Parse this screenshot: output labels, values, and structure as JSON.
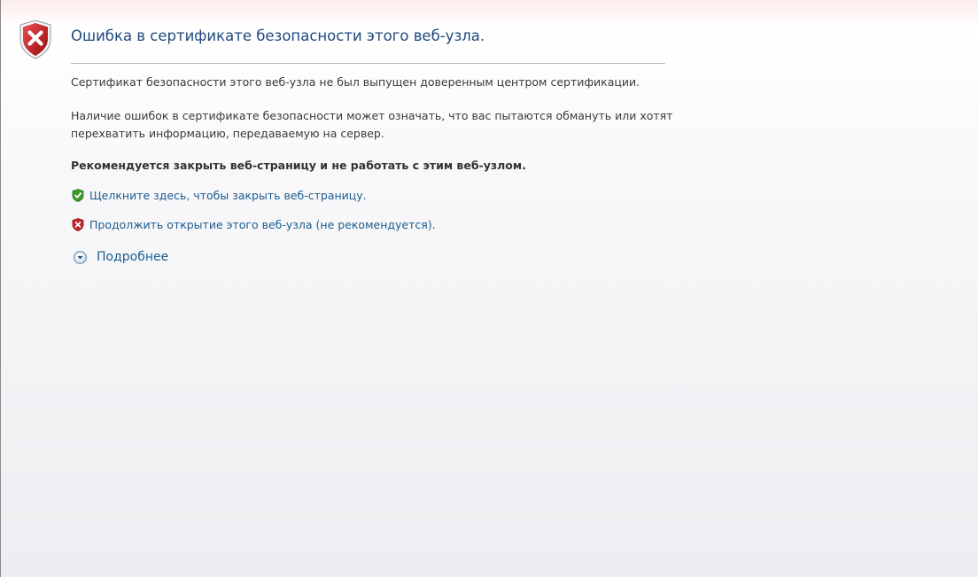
{
  "page": {
    "title": "Ошибка в сертификате безопасности этого веб-узла.",
    "paragraph_1": "Сертификат безопасности этого веб-узла не был выпущен доверенным центром сертификации.",
    "paragraph_2_line_1": "Наличие ошибок в сертификате безопасности может означать, что вас пытаются обмануть или хотят",
    "paragraph_2_line_2": "перехватить информацию, передаваемую на сервер.",
    "recommendation": "Рекомендуется закрыть веб-страницу и не работать с этим веб-узлом."
  },
  "actions": {
    "close_page_label": "Щелкните здесь, чтобы закрыть веб-страницу.",
    "continue_label": "Продолжить открытие этого веб-узла (не рекомендуется).",
    "more_info_label": "Подробнее"
  },
  "icons": {
    "header": "shield-error-icon",
    "close_page": "shield-check-icon",
    "continue": "shield-error-small-icon",
    "more_info": "expand-circle-icon"
  },
  "colors": {
    "title": "#1f497d",
    "link": "#1b5c8f",
    "error_red": "#c0262b",
    "safe_green": "#3f9a2c"
  }
}
